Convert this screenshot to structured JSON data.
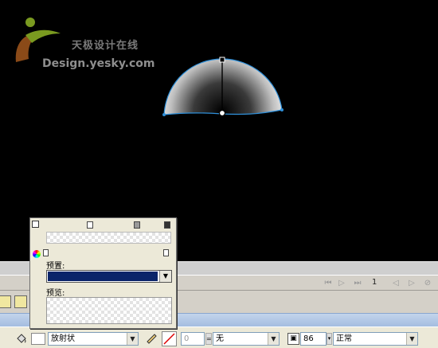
{
  "watermark": {
    "chinese": "天极设计在线",
    "english": "Design.yesky.com"
  },
  "colors": {
    "canvas": "#000000",
    "panel": "#ece9d8",
    "preset_highlight": "#0a246a",
    "selection_outline": "#2f8fd8"
  },
  "playback": {
    "frame": "1"
  },
  "mixer": {
    "preset_label": "预置:",
    "preview_label": "预览:"
  },
  "properties": {
    "fill_type": "放射状",
    "stroke_value": "0",
    "stroke_style": "无",
    "opacity": "86",
    "blend_mode": "正常"
  },
  "icons": {
    "close": "close-icon",
    "color_wheel": "color-wheel-icon",
    "paint_bucket": "paint-bucket-icon",
    "pencil": "pencil-icon",
    "no_stroke": "no-color-icon"
  }
}
